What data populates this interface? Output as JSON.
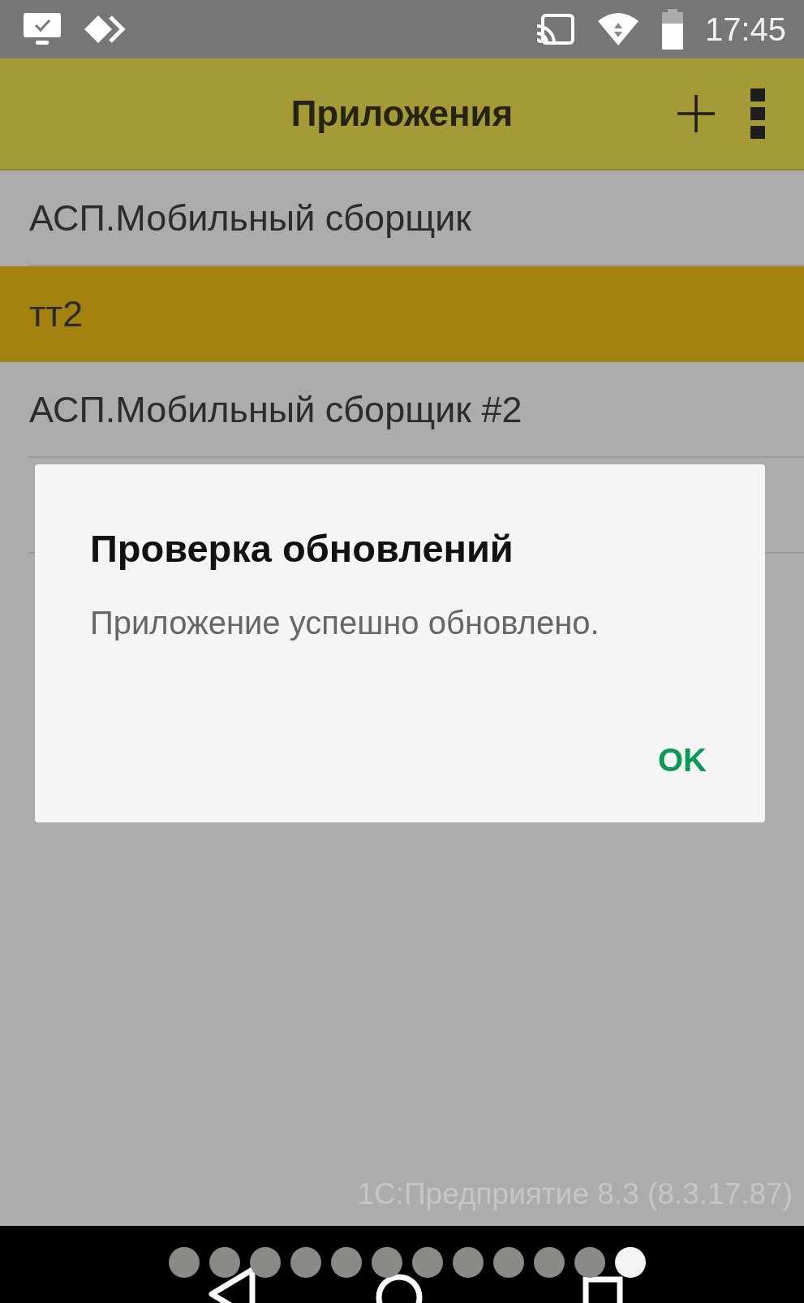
{
  "status_bar": {
    "time": "17:45"
  },
  "app_bar": {
    "title": "Приложения"
  },
  "apps": [
    {
      "name": "АСП.Мобильный сборщик",
      "selected": false
    },
    {
      "name": "тт2",
      "selected": true
    },
    {
      "name": "АСП.Мобильный сборщик #2",
      "selected": false
    },
    {
      "selected": false
    }
  ],
  "dialog": {
    "title": "Проверка обновлений",
    "message": "Приложение успешно обновлено.",
    "button": "OK"
  },
  "footer": "1С:Предприятие 8.3 (8.3.17.87)",
  "gallery_dots": [
    {
      "selected": false
    },
    {
      "selected": false
    },
    {
      "selected": false
    },
    {
      "selected": false
    },
    {
      "selected": false
    },
    {
      "selected": false
    },
    {
      "selected": false
    },
    {
      "selected": false
    },
    {
      "selected": false
    },
    {
      "selected": false
    },
    {
      "selected": false
    },
    {
      "selected": true
    }
  ]
}
